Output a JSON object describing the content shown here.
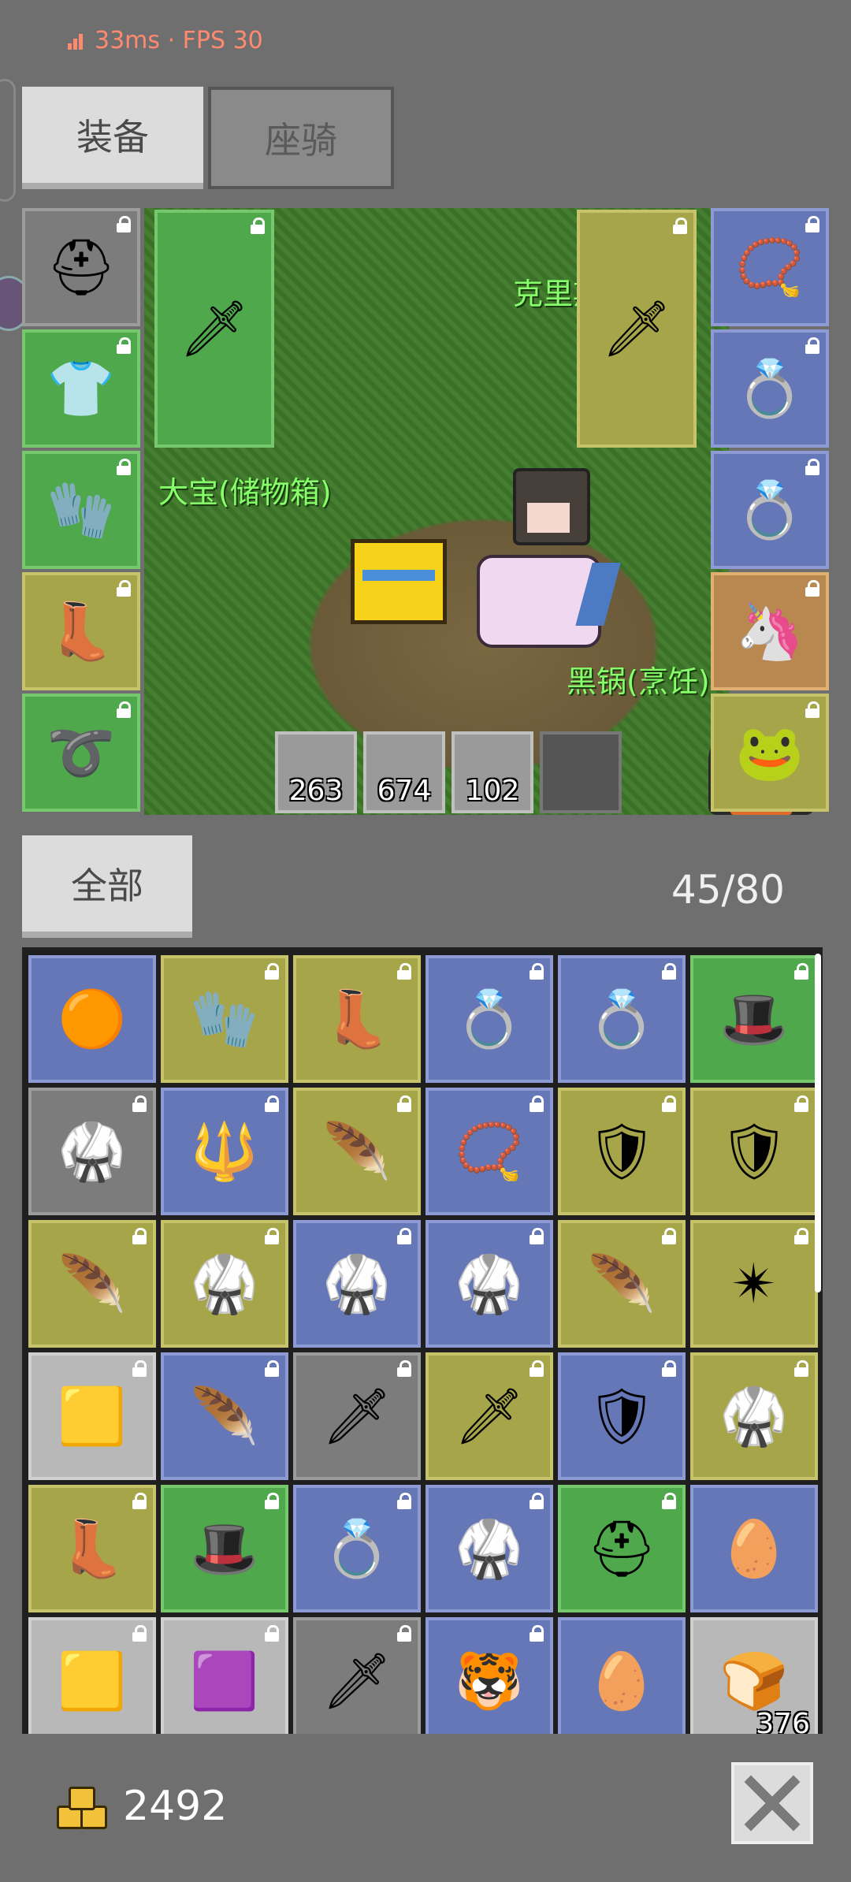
{
  "status": {
    "latency": "33ms",
    "separator": "·",
    "fps": "FPS 30"
  },
  "tabs": [
    {
      "label": "装备",
      "active": true
    },
    {
      "label": "座骑",
      "active": false
    }
  ],
  "scene": {
    "labels": {
      "npc_jeweler": "克里斯珠宝商",
      "chest": "大宝(储物箱)",
      "cook": "黑锅(烹饪)"
    },
    "hud_counts": [
      "263",
      "674",
      "102"
    ]
  },
  "equipment_left": [
    {
      "icon": "horned-helmet-icon",
      "glyph": "⛑",
      "color": "gray"
    },
    {
      "icon": "chainmail-armor-icon",
      "glyph": "👕",
      "color": "green"
    },
    {
      "icon": "gauntlet-icon",
      "glyph": "🧤",
      "color": "green"
    },
    {
      "icon": "boots-icon",
      "glyph": "👢",
      "color": "olive"
    },
    {
      "icon": "belt-icon",
      "glyph": "➰",
      "color": "green"
    }
  ],
  "equipment_right": [
    {
      "icon": "emerald-amulet-icon",
      "glyph": "📿",
      "color": "blue"
    },
    {
      "icon": "ruby-ring-icon",
      "glyph": "💍",
      "color": "blue"
    },
    {
      "icon": "sapphire-ring-icon",
      "glyph": "💍",
      "color": "blue"
    },
    {
      "icon": "mount-portrait-icon",
      "glyph": "🦄",
      "color": "orange"
    },
    {
      "icon": "pet-portrait-icon",
      "glyph": "🐸",
      "color": "olive"
    }
  ],
  "weapons": [
    {
      "icon": "purple-sword-icon",
      "glyph": "🗡",
      "color": "green"
    },
    {
      "icon": "steel-sword-icon",
      "glyph": "🗡",
      "color": "olive"
    }
  ],
  "filter": {
    "label": "全部"
  },
  "capacity": "45/80",
  "inventory": [
    {
      "icon": "seed-icon",
      "glyph": "🟠",
      "color": "blue",
      "locked": false
    },
    {
      "icon": "chain-gauntlet-icon",
      "glyph": "🧤",
      "color": "olive",
      "locked": true
    },
    {
      "icon": "leather-boots-icon",
      "glyph": "👢",
      "color": "olive",
      "locked": true
    },
    {
      "icon": "ruby-ring-icon",
      "glyph": "💍",
      "color": "blue",
      "locked": true
    },
    {
      "icon": "ruby-ring-small-icon",
      "glyph": "💍",
      "color": "blue",
      "locked": true
    },
    {
      "icon": "purple-hat-icon",
      "glyph": "🎩",
      "color": "green",
      "locked": true
    },
    {
      "icon": "chainmail-icon",
      "glyph": "🥋",
      "color": "gray",
      "locked": true
    },
    {
      "icon": "trident-icon",
      "glyph": "🔱",
      "color": "blue",
      "locked": true
    },
    {
      "icon": "red-feather-icon",
      "glyph": "🪶",
      "color": "olive",
      "locked": true
    },
    {
      "icon": "horn-amulet-icon",
      "glyph": "📿",
      "color": "blue",
      "locked": true
    },
    {
      "icon": "kite-shield-icon",
      "glyph": "🛡",
      "color": "olive",
      "locked": true
    },
    {
      "icon": "round-shield-icon",
      "glyph": "🛡",
      "color": "olive",
      "locked": true
    },
    {
      "icon": "red-feather-icon",
      "glyph": "🪶",
      "color": "olive",
      "locked": true
    },
    {
      "icon": "dark-armor-icon",
      "glyph": "🥋",
      "color": "olive",
      "locked": true
    },
    {
      "icon": "dark-armor-icon",
      "glyph": "🥋",
      "color": "blue",
      "locked": true
    },
    {
      "icon": "dark-armor-gem-icon",
      "glyph": "🥋",
      "color": "blue",
      "locked": true
    },
    {
      "icon": "red-feather-icon",
      "glyph": "🪶",
      "color": "olive",
      "locked": true
    },
    {
      "icon": "morning-star-icon",
      "glyph": "✴",
      "color": "olive",
      "locked": true
    },
    {
      "icon": "pale-gem-icon",
      "glyph": "🟨",
      "color": "light",
      "locked": true
    },
    {
      "icon": "red-feather-icon",
      "glyph": "🪶",
      "color": "blue",
      "locked": true
    },
    {
      "icon": "gem-spear-icon",
      "glyph": "🗡",
      "color": "gray",
      "locked": true
    },
    {
      "icon": "broad-sword-icon",
      "glyph": "🗡",
      "color": "olive",
      "locked": true
    },
    {
      "icon": "round-shield-icon",
      "glyph": "🛡",
      "color": "blue",
      "locked": true
    },
    {
      "icon": "dark-armor-icon",
      "glyph": "🥋",
      "color": "olive",
      "locked": true
    },
    {
      "icon": "leather-boots-icon",
      "glyph": "👢",
      "color": "olive",
      "locked": true
    },
    {
      "icon": "purple-hat-icon",
      "glyph": "🎩",
      "color": "green",
      "locked": true
    },
    {
      "icon": "sapphire-ring-icon",
      "glyph": "💍",
      "color": "blue",
      "locked": true
    },
    {
      "icon": "dark-armor-icon",
      "glyph": "🥋",
      "color": "blue",
      "locked": true
    },
    {
      "icon": "gold-helmet-icon",
      "glyph": "⛑",
      "color": "green",
      "locked": true
    },
    {
      "icon": "egg-icon",
      "glyph": "🥚",
      "color": "blue",
      "locked": false
    },
    {
      "icon": "gold-ore-icon",
      "glyph": "🟨",
      "color": "light",
      "locked": true
    },
    {
      "icon": "amethyst-icon",
      "glyph": "🟪",
      "color": "light",
      "locked": true
    },
    {
      "icon": "gem-spear-icon",
      "glyph": "🗡",
      "color": "gray",
      "locked": true
    },
    {
      "icon": "pet-card-icon",
      "glyph": "🐯",
      "color": "blue",
      "locked": true
    },
    {
      "icon": "egg-icon",
      "glyph": "🥚",
      "color": "blue",
      "locked": false
    },
    {
      "icon": "bread-icon",
      "glyph": "🍞",
      "color": "light",
      "locked": false,
      "count": "376"
    }
  ],
  "gold": "2492",
  "close_icon": "close-icon"
}
